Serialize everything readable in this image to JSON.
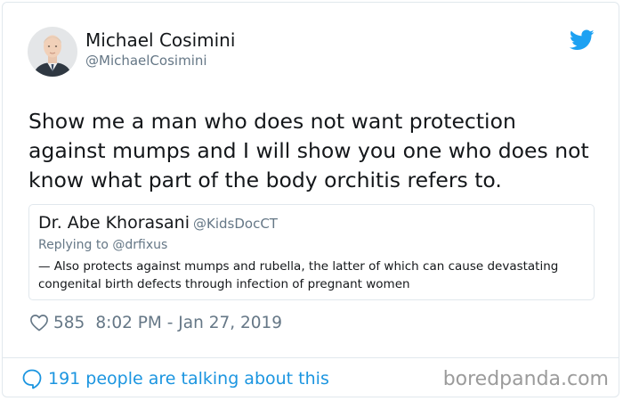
{
  "tweet": {
    "author": {
      "name": "Michael Cosimini",
      "handle": "@MichaelCosimini"
    },
    "text": "Show me a man who does not want protection against mumps and I will show you one who does not know what part of the body orchitis refers to.",
    "quoted": {
      "name": "Dr. Abe Khorasani",
      "handle": "@KidsDocCT",
      "replying_to": "Replying to @drfixus",
      "text": "— Also protects against mumps and rubella, the latter of which can cause devastating congenital birth defects through infection of pregnant women"
    },
    "likes": "585",
    "timestamp": "8:02 PM - Jan 27, 2019",
    "talking": "191 people are talking about this"
  },
  "watermark": "boredpanda.com",
  "colors": {
    "twitter_blue": "#1da1f2",
    "link_blue": "#1b95e0",
    "muted_gray": "#657786",
    "border": "#e1e8ed"
  },
  "icons": {
    "logo": "twitter-bird-icon",
    "like": "heart-icon",
    "talk": "speech-bubble-icon"
  }
}
